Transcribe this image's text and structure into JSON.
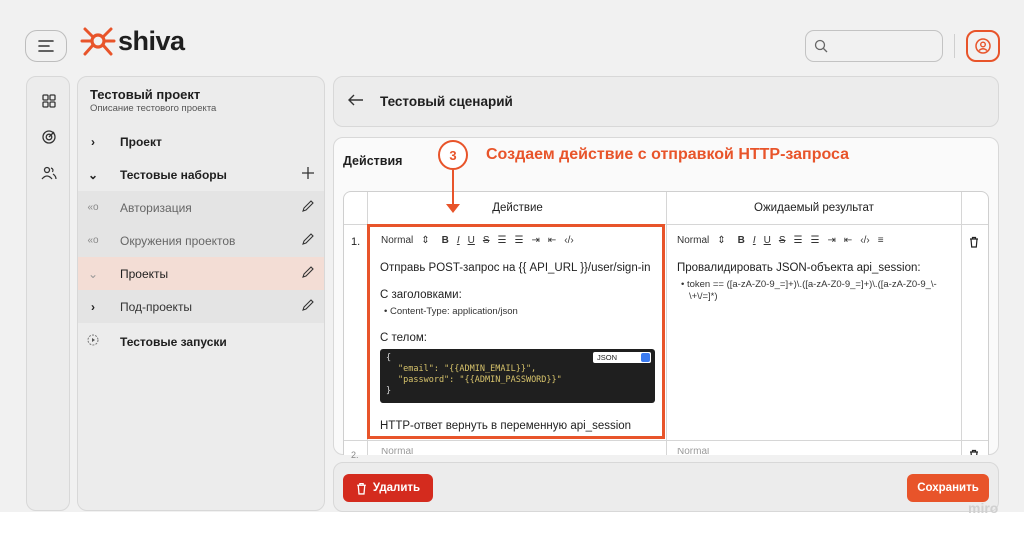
{
  "app": {
    "logo_text": "shiva",
    "accent": "#e8542a",
    "danger": "#d42b1e"
  },
  "search": {
    "placeholder": ""
  },
  "sidebar": {
    "project_title": "Тестовый проект",
    "project_desc": "Описание тестового проекта",
    "items": [
      {
        "label": "Проект"
      },
      {
        "label": "Тестовые наборы"
      },
      {
        "label": "Авторизация"
      },
      {
        "label": "Окружения проектов"
      },
      {
        "label": "Проекты"
      },
      {
        "label": "Под-проекты"
      },
      {
        "label": "Тестовые запуски"
      }
    ]
  },
  "main": {
    "title": "Тестовый сценарий",
    "section_label": "Действия",
    "annotation": {
      "step": "3",
      "text": "Создаем действие с отправкой HTTP-запроса"
    },
    "table": {
      "headers": [
        "Действие",
        "Ожидаемый результат"
      ],
      "toolbar": {
        "style": "Normal",
        "b": "B",
        "i": "I",
        "u": "U",
        "s": "S"
      },
      "row1": {
        "num": "1.",
        "action": {
          "line1": "Отправь POST-запрос на {{ API_URL }}/user/sign-in",
          "headers_label": "С заголовками:",
          "header_item": "Content-Type: application/json",
          "body_label": "С телом:",
          "code_open": "{",
          "code_email_key": "\"email\": ",
          "code_email_val": "\"{{ADMIN_EMAIL}}\",",
          "code_pass_key": "\"password\": ",
          "code_pass_val": "\"{{ADMIN_PASSWORD}}\"",
          "code_close": "}",
          "code_lang": "JSON",
          "result_line": "HTTP-ответ вернуть в переменную api_session"
        },
        "expected": {
          "line1": "Провалидировать JSON-объекта api_session:",
          "item1a": "token == ([a-zA-Z0-9_=]+)\\.([a-zA-Z0-9_=]+)\\.([a-zA-Z0-9_\\-",
          "item1b": "\\+\\/=]*)"
        }
      },
      "row2": {
        "num": "2."
      }
    },
    "delete_label": "Удалить",
    "save_label": "Сохранить"
  },
  "watermark": "miro"
}
